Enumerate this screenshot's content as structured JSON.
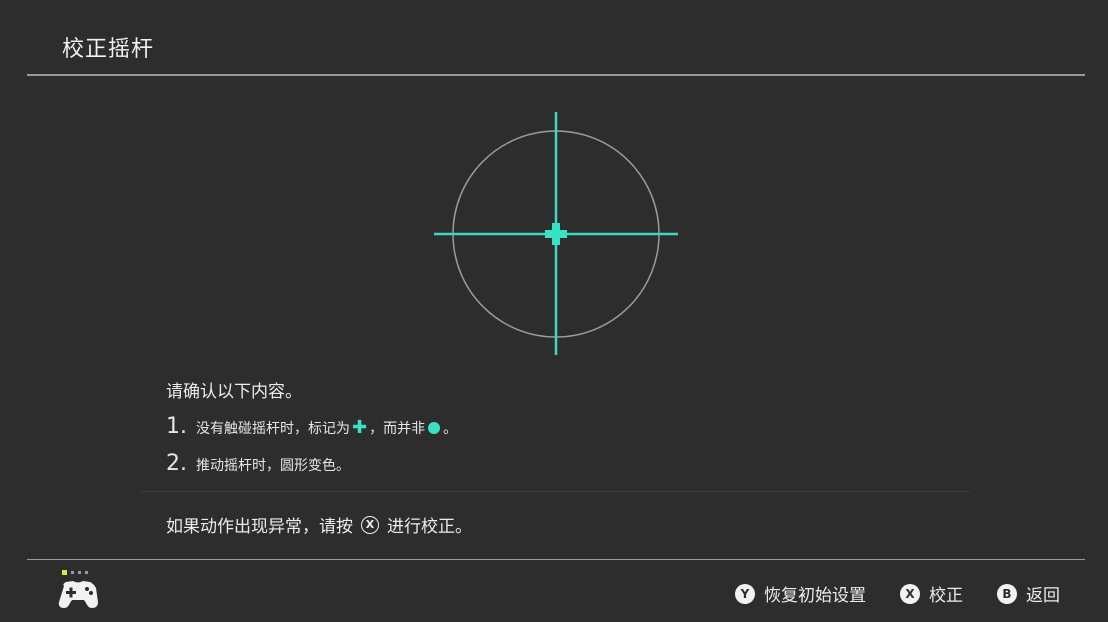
{
  "header": {
    "title": "校正摇杆"
  },
  "instructions": {
    "title": "请确认以下内容。",
    "steps": [
      {
        "num": "1.",
        "text_a": "没有触碰摇杆时，标记为",
        "text_b": "，而并非",
        "text_c": "。"
      },
      {
        "num": "2.",
        "text": "推动摇杆时，圆形变色。"
      }
    ]
  },
  "footer_note": {
    "prefix": "如果动作出现异常，请按",
    "button_glyph": "X",
    "suffix": "进行校正。"
  },
  "footer": {
    "actions": [
      {
        "glyph": "Y",
        "label": "恢复初始设置"
      },
      {
        "glyph": "X",
        "label": "校正"
      },
      {
        "glyph": "B",
        "label": "返回"
      }
    ]
  },
  "colors": {
    "background": "#2d2d2d",
    "accent_marker": "#38e3c5",
    "crosshair": "#3fd6c4",
    "active_indicator": "#c6f23a"
  },
  "icons": {
    "controller": "gamepad-icon",
    "marker_plus": "plus-marker-icon",
    "marker_dot": "dot-marker-icon"
  }
}
